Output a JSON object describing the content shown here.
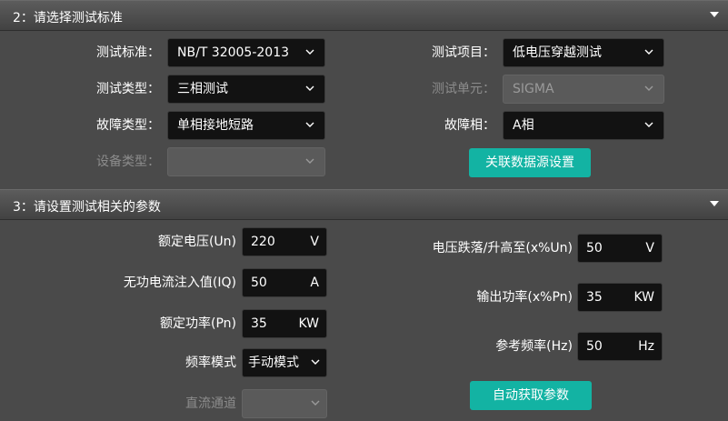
{
  "section2": {
    "title": "2：请选择测试标准",
    "fields": {
      "standard": {
        "label": "测试标准：",
        "value": "NB/T 32005-2013"
      },
      "test_type": {
        "label": "测试类型：",
        "value": "三相测试"
      },
      "fault_type": {
        "label": "故障类型：",
        "value": "单相接地短路"
      },
      "device_type": {
        "label": "设备类型：",
        "value": ""
      },
      "test_item": {
        "label": "测试项目：",
        "value": "低电压穿越测试"
      },
      "test_unit": {
        "label": "测试单元：",
        "value": "SIGMA"
      },
      "fault_phase": {
        "label": "故障相：",
        "value": "A相"
      }
    },
    "link_button": "关联数据源设置"
  },
  "section3": {
    "title": "3：请设置测试相关的参数",
    "fields": {
      "rated_voltage": {
        "label": "额定电压(Un)",
        "value": "220",
        "unit": "V"
      },
      "reactive_current": {
        "label": "无功电流注入值(IQ)",
        "value": "50",
        "unit": "A"
      },
      "rated_power": {
        "label": "额定功率(Pn)",
        "value": "35",
        "unit": "KW"
      },
      "freq_mode": {
        "label": "频率模式",
        "value": "手动模式"
      },
      "dc_channel": {
        "label": "直流通道",
        "value": ""
      },
      "voltage_drop": {
        "label": "电压跌落/升高至(x%Un)",
        "value": "50",
        "unit": "V"
      },
      "output_power": {
        "label": "输出功率(x%Pn)",
        "value": "35",
        "unit": "KW"
      },
      "ref_freq": {
        "label": "参考频率(Hz)",
        "value": "50",
        "unit": "Hz"
      }
    },
    "auto_button": "自动获取参数"
  }
}
